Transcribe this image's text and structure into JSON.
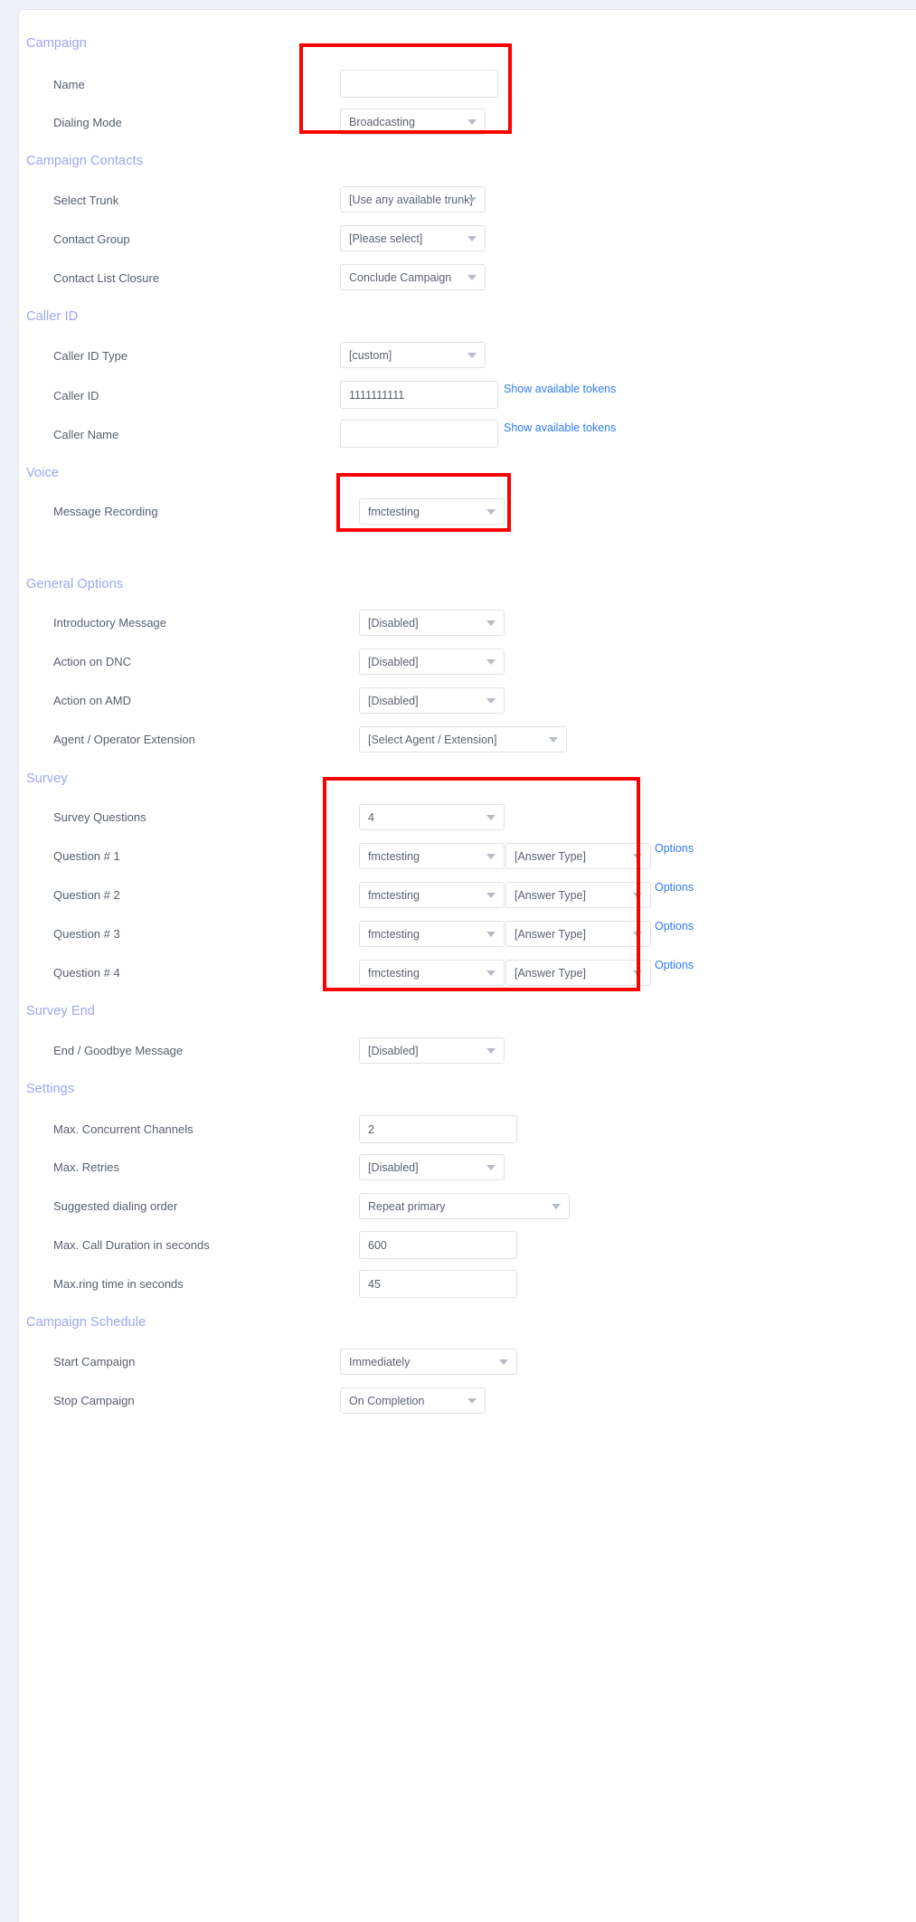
{
  "page": {
    "background": "#eef2f6",
    "card_background": "#ffffff",
    "section_heading_color": "#9aa7f0",
    "link_color": "#2f7bf6",
    "highlight_color": "#fb0202"
  },
  "sections": {
    "campaign": {
      "title": "Campaign",
      "rows": {
        "name": {
          "label": "Name",
          "value": "",
          "type": "text"
        },
        "dialing_mode": {
          "label": "Dialing Mode",
          "value": "Broadcasting",
          "type": "select"
        }
      }
    },
    "campaign_contacts": {
      "title": "Campaign Contacts",
      "rows": {
        "select_trunk": {
          "label": "Select Trunk",
          "value": "[Use any available trunk]",
          "type": "select"
        },
        "contact_group": {
          "label": "Contact Group",
          "value": "[Please select]",
          "type": "select"
        },
        "contact_list_closure": {
          "label": "Contact List Closure",
          "value": "Conclude Campaign",
          "type": "select"
        }
      }
    },
    "caller_id": {
      "title": "Caller ID",
      "rows": {
        "caller_id_type": {
          "label": "Caller ID Type",
          "value": "[custom]",
          "type": "select"
        },
        "caller_id": {
          "label": "Caller ID",
          "value": "1111111111",
          "type": "text",
          "link": "Show available tokens"
        },
        "caller_name": {
          "label": "Caller Name",
          "value": "",
          "type": "text",
          "link": "Show available tokens"
        }
      }
    },
    "voice": {
      "title": "Voice",
      "rows": {
        "message_recording": {
          "label": "Message Recording",
          "value": "fmctesting",
          "type": "select"
        }
      }
    },
    "general_options": {
      "title": "General Options",
      "rows": {
        "introductory_message": {
          "label": "Introductory Message",
          "value": "[Disabled]",
          "type": "select"
        },
        "action_on_dnc": {
          "label": "Action on DNC",
          "value": "[Disabled]",
          "type": "select"
        },
        "action_on_amd": {
          "label": "Action on AMD",
          "value": "[Disabled]",
          "type": "select"
        },
        "agent_operator_extension": {
          "label": "Agent / Operator Extension",
          "value": "[Select Agent / Extension]",
          "type": "select"
        }
      }
    },
    "survey": {
      "title": "Survey",
      "questions_count_label": "Survey Questions",
      "questions_count_value": "4",
      "options_link": "Options",
      "questions": [
        {
          "label": "Question # 1",
          "recording": "fmctesting",
          "answer_type": "[Answer Type]",
          "options": "Options"
        },
        {
          "label": "Question # 2",
          "recording": "fmctesting",
          "answer_type": "[Answer Type]",
          "options": "Options"
        },
        {
          "label": "Question # 3",
          "recording": "fmctesting",
          "answer_type": "[Answer Type]",
          "options": "Options"
        },
        {
          "label": "Question # 4",
          "recording": "fmctesting",
          "answer_type": "[Answer Type]",
          "options": "Options"
        }
      ]
    },
    "survey_end": {
      "title": "Survey End",
      "rows": {
        "end_goodbye_message": {
          "label": "End / Goodbye Message",
          "value": "[Disabled]",
          "type": "select"
        }
      }
    },
    "settings": {
      "title": "Settings",
      "rows": {
        "max_concurrent_channels": {
          "label": "Max. Concurrent Channels",
          "value": "2",
          "type": "text"
        },
        "max_retries": {
          "label": "Max. Retries",
          "value": "[Disabled]",
          "type": "select"
        },
        "suggested_dialing_order": {
          "label": "Suggested dialing order",
          "value": "Repeat primary",
          "type": "select"
        },
        "max_call_duration": {
          "label": "Max. Call Duration in seconds",
          "value": "600",
          "type": "text"
        },
        "max_ring_time": {
          "label": "Max.ring time in seconds",
          "value": "45",
          "type": "text"
        }
      }
    },
    "campaign_schedule": {
      "title": "Campaign Schedule",
      "rows": {
        "start_campaign": {
          "label": "Start Campaign",
          "value": "Immediately",
          "type": "select"
        },
        "stop_campaign": {
          "label": "Stop Campaign",
          "value": "On Completion",
          "type": "select"
        }
      }
    }
  }
}
